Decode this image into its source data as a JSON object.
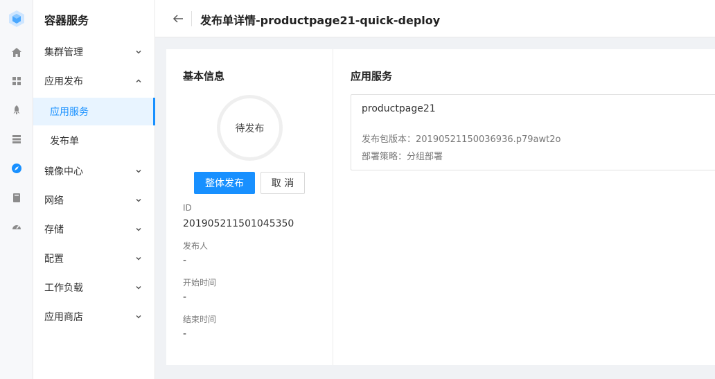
{
  "rail": {
    "icons": [
      "logo-cube-icon",
      "home-icon",
      "dashboard-grid-icon",
      "rocket-icon",
      "server-list-icon",
      "compass-icon",
      "book-icon",
      "gauge-icon"
    ],
    "accent": "#1890ff"
  },
  "sidebar": {
    "title": "容器服务",
    "items": [
      {
        "label": "集群管理",
        "expanded": false
      },
      {
        "label": "应用发布",
        "expanded": true,
        "children": [
          {
            "label": "应用服务",
            "active": true
          },
          {
            "label": "发布单",
            "active": false
          }
        ]
      },
      {
        "label": "镜像中心",
        "expanded": false
      },
      {
        "label": "网络",
        "expanded": false
      },
      {
        "label": "存储",
        "expanded": false
      },
      {
        "label": "配置",
        "expanded": false
      },
      {
        "label": "工作负载",
        "expanded": false
      },
      {
        "label": "应用商店",
        "expanded": false
      }
    ]
  },
  "header": {
    "title": "发布单详情-productpage21-quick-deploy"
  },
  "basic_info": {
    "title": "基本信息",
    "status": "待发布",
    "primary_button": "整体发布",
    "cancel_button": "取 消",
    "fields": [
      {
        "label": "ID",
        "value": "201905211501045350"
      },
      {
        "label": "发布人",
        "value": "-"
      },
      {
        "label": "开始时间",
        "value": "-"
      },
      {
        "label": "结束时间",
        "value": "-"
      }
    ]
  },
  "app_service": {
    "title": "应用服务",
    "card": {
      "name": "productpage21",
      "version_line": "发布包版本：20190521150036936.p79awt2o",
      "strategy_line": "部署策略：分组部署"
    }
  }
}
